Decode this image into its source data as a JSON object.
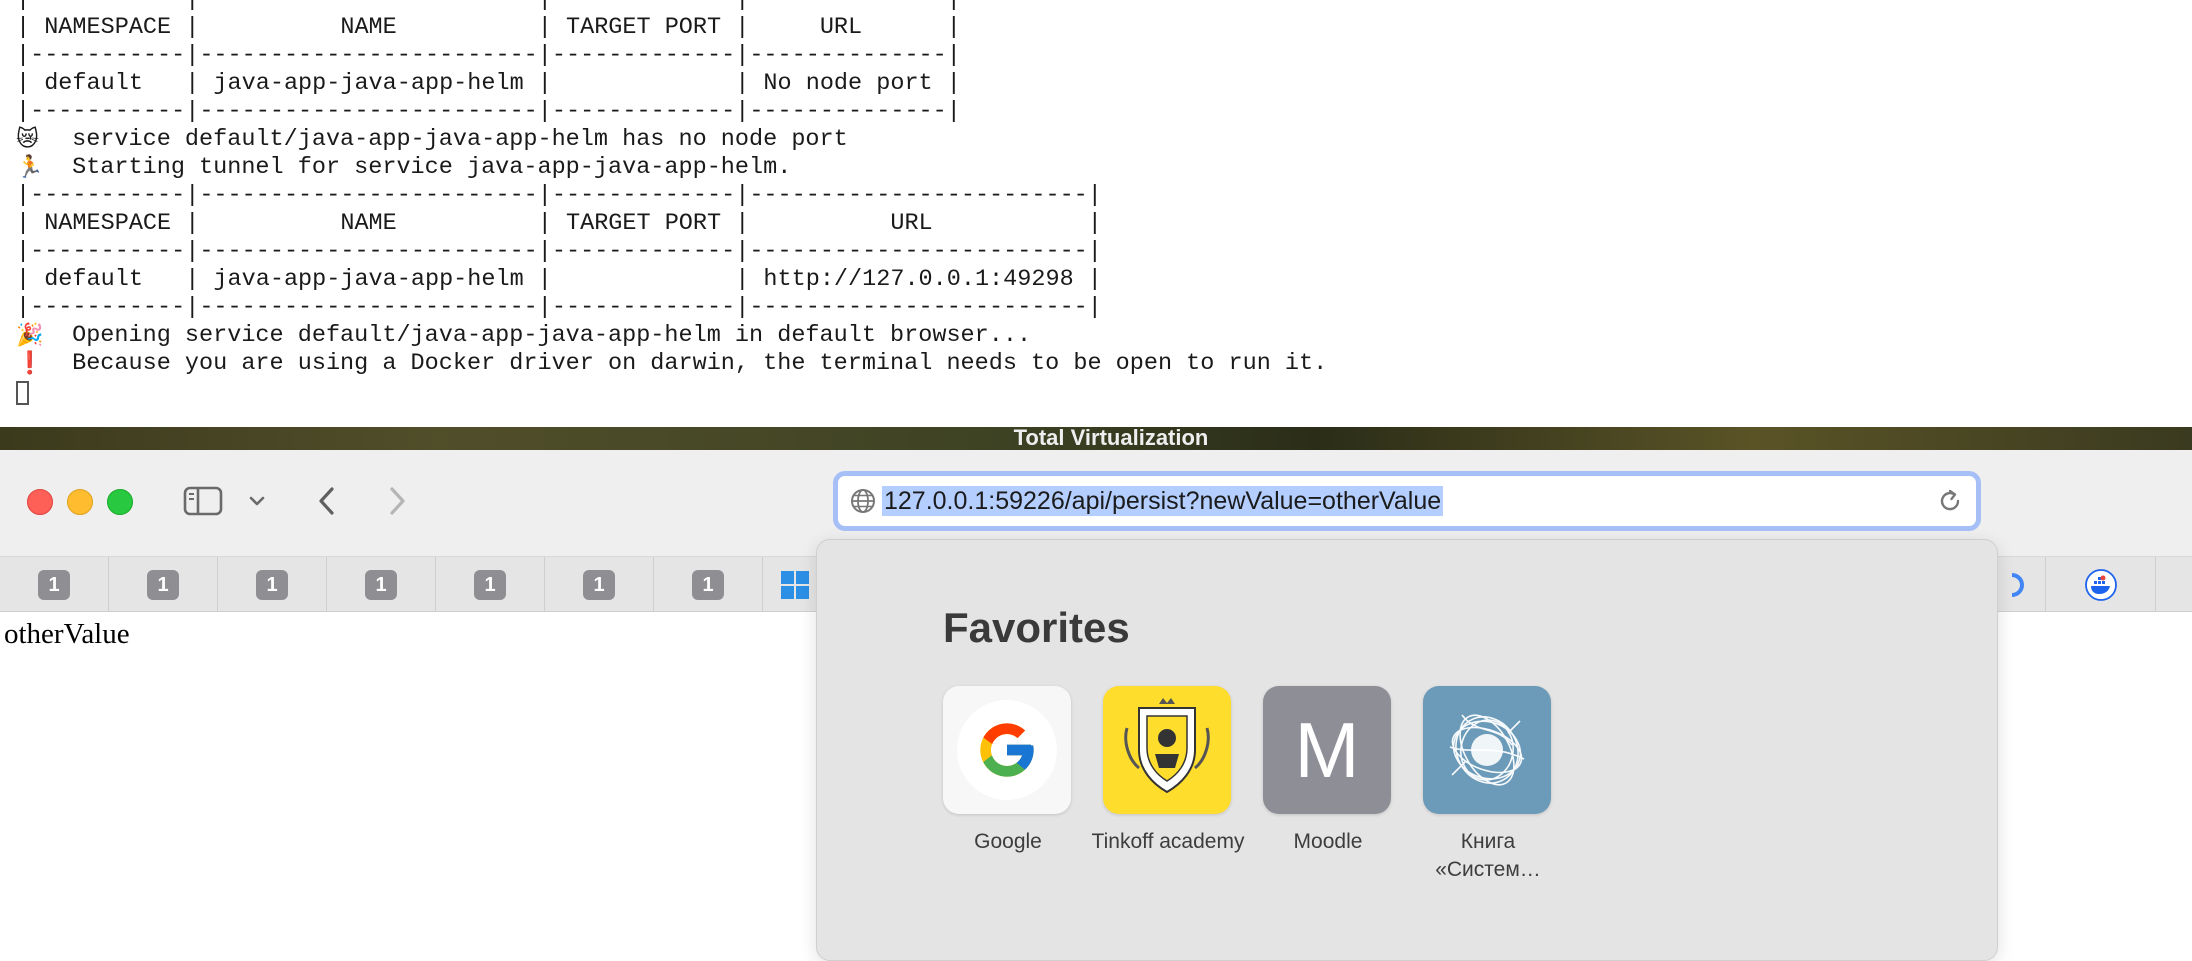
{
  "terminal": {
    "lines": [
      {
        "emoji": "",
        "text": "|-----------|------------------------|-------------|--------------|"
      },
      {
        "emoji": "",
        "text": "| NAMESPACE |          NAME          | TARGET PORT |     URL      |"
      },
      {
        "emoji": "",
        "text": "|-----------|------------------------|-------------|--------------|"
      },
      {
        "emoji": "",
        "text": "| default   | java-app-java-app-helm |             | No node port |"
      },
      {
        "emoji": "",
        "text": "|-----------|------------------------|-------------|--------------|"
      },
      {
        "emoji": "😿",
        "text": " service default/java-app-java-app-helm has no node port"
      },
      {
        "emoji": "🏃",
        "text": " Starting tunnel for service java-app-java-app-helm."
      },
      {
        "emoji": "",
        "text": "|-----------|------------------------|-------------|------------------------|"
      },
      {
        "emoji": "",
        "text": "| NAMESPACE |          NAME          | TARGET PORT |          URL           |"
      },
      {
        "emoji": "",
        "text": "|-----------|------------------------|-------------|------------------------|"
      },
      {
        "emoji": "",
        "text": "| default   | java-app-java-app-helm |             | http://127.0.0.1:49298 |"
      },
      {
        "emoji": "",
        "text": "|-----------|------------------------|-------------|------------------------|"
      },
      {
        "emoji": "🎉",
        "text": " Opening service default/java-app-java-app-helm in default browser..."
      },
      {
        "emoji": "❗",
        "text": " Because you are using a Docker driver on darwin, the terminal needs to be open to run it."
      }
    ]
  },
  "desktop": {
    "window_title": "Total Virtualization"
  },
  "browser": {
    "url": "127.0.0.1:59226/api/persist?newValue=otherValue",
    "favorites_bar_badges": [
      "1",
      "1",
      "1",
      "1",
      "1",
      "1",
      "1"
    ],
    "page_text": "otherValue",
    "favorites": {
      "title": "Favorites",
      "items": [
        {
          "label": "Google",
          "icon": "google-icon"
        },
        {
          "label": "Tinkoff academy",
          "icon": "tinkoff-icon"
        },
        {
          "label": "Moodle",
          "letter": "M",
          "icon": "moodle-icon"
        },
        {
          "label": "Книга «Систем…",
          "icon": "kniga-icon"
        }
      ]
    }
  }
}
